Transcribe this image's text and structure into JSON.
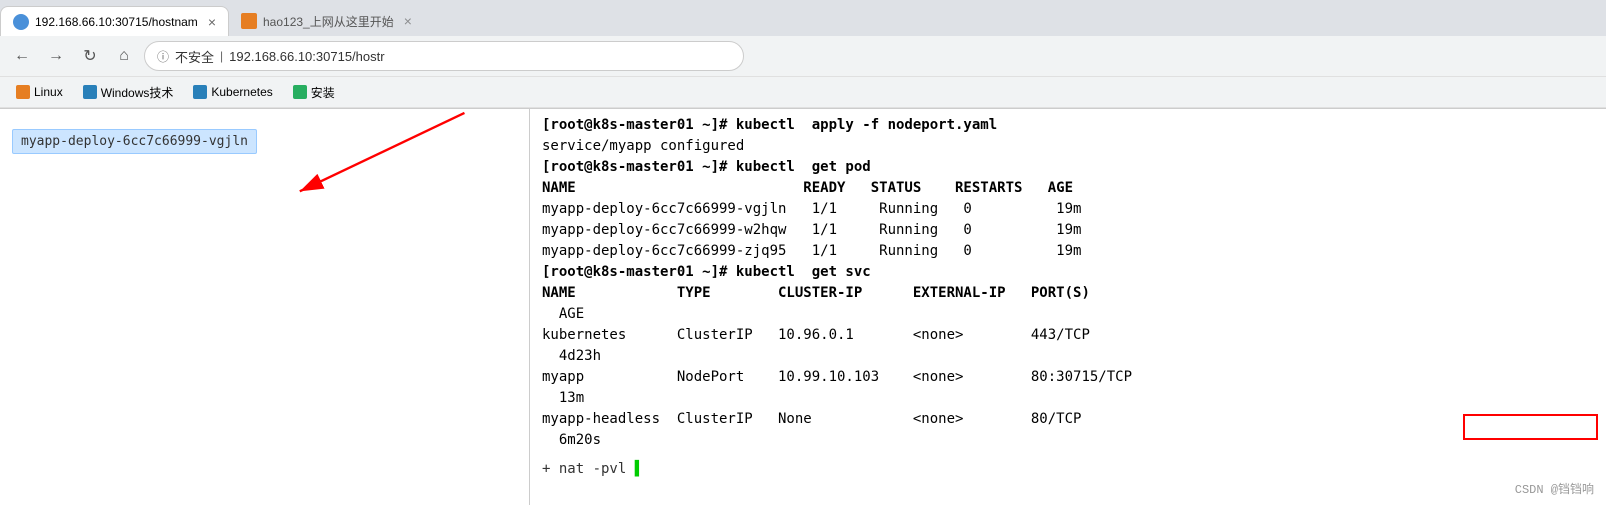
{
  "browser": {
    "tabs": [
      {
        "id": "tab1",
        "favicon_color": "#4a90d9",
        "title": "192.168.66.10:30715/hostnam",
        "active": true
      },
      {
        "id": "tab2",
        "favicon_color": "#27ae60",
        "title": "hao123_上网从这里开始",
        "active": false
      }
    ],
    "address": {
      "insecure_label": "不安全",
      "url": "192.168.66.10:30715/hostr"
    },
    "bookmarks": [
      {
        "label": "Linux",
        "color": "orange"
      },
      {
        "label": "Windows技术",
        "color": "blue-dark"
      },
      {
        "label": "Kubernetes",
        "color": "blue-dark"
      },
      {
        "label": "安装",
        "color": "green"
      }
    ]
  },
  "page": {
    "pod_name": "myapp-deploy-6cc7c66999-vgjln"
  },
  "terminal": {
    "lines": [
      {
        "type": "prompt",
        "text": "[root@k8s-master01 ~]# kubectl  apply -f nodeport.yaml"
      },
      {
        "type": "output",
        "text": "service/myapp configured"
      },
      {
        "type": "prompt",
        "text": "[root@k8s-master01 ~]# kubectl  get pod"
      },
      {
        "type": "output-header",
        "text": "NAME                           READY   STATUS    RESTARTS   AGE"
      },
      {
        "type": "output",
        "text": "myapp-deploy-6cc7c66999-vgjln   1/1     Running   0          19m"
      },
      {
        "type": "output",
        "text": "myapp-deploy-6cc7c66999-w2hqw   1/1     Running   0          19m"
      },
      {
        "type": "output",
        "text": "myapp-deploy-6cc7c66999-zjq95   1/1     Running   0          19m"
      },
      {
        "type": "prompt",
        "text": "[root@k8s-master01 ~]# kubectl  get svc"
      },
      {
        "type": "output-header",
        "text": "NAME            TYPE        CLUSTER-IP      EXTERNAL-IP   PORT(S)"
      },
      {
        "type": "output",
        "text": "  AGE"
      },
      {
        "type": "output",
        "text": "kubernetes      ClusterIP   10.96.0.1       <none>        443/TCP"
      },
      {
        "type": "output",
        "text": "  4d23h"
      },
      {
        "type": "output",
        "text": "myapp           NodePort    10.99.10.103    <none>        80:30715/TCP"
      },
      {
        "type": "output",
        "text": "  13m"
      },
      {
        "type": "output",
        "text": "myapp-headless  ClusterIP   None            <none>        80/TCP"
      },
      {
        "type": "output",
        "text": "  6m20s"
      }
    ],
    "bottom_command": "+ nat -pvl",
    "watermark": "CSDN @铛铛响"
  }
}
